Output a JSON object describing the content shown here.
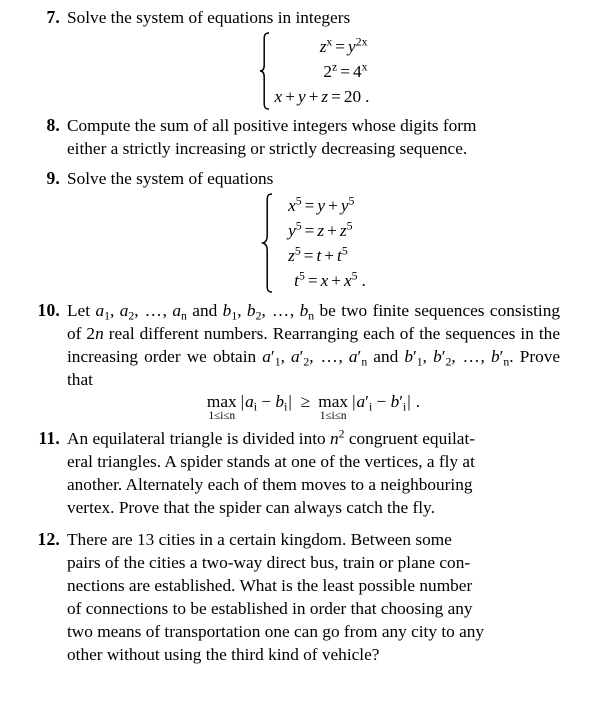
{
  "document": {
    "type": "math-problem-set",
    "problems": [
      {
        "number": "7.",
        "text_before": "Solve the system of equations in integers",
        "display": {
          "kind": "brace-system",
          "rows": [
            "z^x = y^{2x}",
            "2^z = 4^x",
            "x + y + z = 20 ."
          ]
        }
      },
      {
        "number": "8.",
        "line1": "Compute the sum of all positive integers whose digits form",
        "line2": "either a strictly increasing or strictly decreasing sequence."
      },
      {
        "number": "9.",
        "text_before": "Solve the system of equations",
        "display": {
          "kind": "brace-system",
          "rows": [
            "x^5 = y + y^5",
            "y^5 = z + z^5",
            "z^5 = t + t^5",
            "t^5 = x + x^5 ."
          ]
        }
      },
      {
        "number": "10.",
        "text_before_1": "Let ",
        "text_before_2": " and ",
        "text_before_3": " be two finite sequences consisting of ",
        "text_before_4": " real different numbers. Rearranging each of the sequences in the increasing order we obtain ",
        "text_before_5": " and ",
        "text_before_6": ". Prove that",
        "display": {
          "kind": "inequality",
          "left_operator": "max",
          "left_limits": "1≤i≤n",
          "left_expr": "|a_i − b_i|",
          "relation": "≥",
          "right_operator": "max",
          "right_limits": "1≤i≤n",
          "right_expr": "|a'_i − b'_i| ."
        }
      },
      {
        "number": "11.",
        "line1": "An equilateral triangle is divided into ",
        "line1_math": "n",
        "line1_sup": "2",
        "line1_end": " congruent equilat-",
        "line2": "eral triangles. A spider stands at one of the vertices, a fly at",
        "line3": "another. Alternately each of them moves to a neighbouring",
        "line4": "vertex. Prove that the spider can always catch the fly."
      },
      {
        "number": "12.",
        "line1": "There are 13 cities in a certain kingdom.  Between some",
        "line2": "pairs of the cities a two-way direct bus, train or plane con-",
        "line3": "nections are established. What is the least possible number",
        "line4": "of connections to be established in order that choosing any",
        "line5": "two means of transportation one can go from any city to any",
        "line6": "other without using the third kind of vehicle?"
      }
    ],
    "symbols": {
      "equals": "=",
      "plus": "+",
      "minus": "−",
      "geq": "≥",
      "period": ".",
      "comma": ",",
      "ellipsis": ", … ,",
      "bar": "|",
      "prime": "′",
      "max": "max",
      "limits": "1≤i≤n",
      "var_x": "x",
      "var_y": "y",
      "var_z": "z",
      "var_t": "t",
      "var_a": "a",
      "var_b": "b",
      "var_n": "n",
      "var_i": "i",
      "num_2": "2",
      "num_4": "4",
      "num_5": "5",
      "num_20": "20",
      "sub_1": "1",
      "sub_2": "2",
      "sup_2x": "2x"
    },
    "colors": {
      "page_background": "#ffffff",
      "text": "#000000"
    }
  }
}
